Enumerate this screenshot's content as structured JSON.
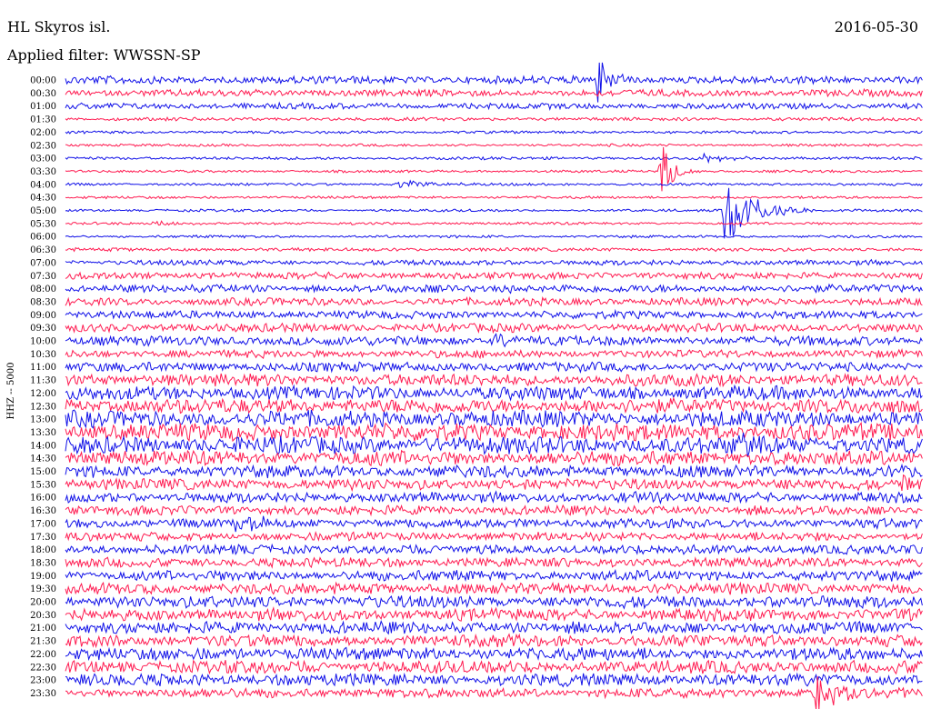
{
  "header": {
    "station": "HL Skyros isl.",
    "filter": "Applied filter: WWSSN-SP",
    "date": "2016-05-30"
  },
  "colors": {
    "trace_a": "#1010e8",
    "trace_b": "#ff1a50",
    "background": "#ffffff"
  },
  "chart_data": {
    "type": "line",
    "title": "",
    "ylabel": "HHZ -- 5000",
    "x_domain_minutes": [
      0,
      30
    ],
    "row_labels": [
      "00:00",
      "00:30",
      "01:00",
      "01:30",
      "02:00",
      "02:30",
      "03:00",
      "03:30",
      "04:00",
      "04:30",
      "05:00",
      "05:30",
      "06:00",
      "06:30",
      "07:00",
      "07:30",
      "08:00",
      "08:30",
      "09:00",
      "09:30",
      "10:00",
      "10:30",
      "11:00",
      "11:30",
      "12:00",
      "12:30",
      "13:00",
      "13:30",
      "14:00",
      "14:30",
      "15:00",
      "15:30",
      "16:00",
      "16:30",
      "17:00",
      "17:30",
      "18:00",
      "18:30",
      "19:00",
      "19:30",
      "20:00",
      "20:30",
      "21:00",
      "21:30",
      "22:00",
      "22:30",
      "23:00",
      "23:30"
    ],
    "noise_level": [
      0.35,
      0.3,
      0.25,
      0.1,
      0.06,
      0.05,
      0.07,
      0.05,
      0.05,
      0.05,
      0.05,
      0.05,
      0.05,
      0.1,
      0.2,
      0.3,
      0.35,
      0.35,
      0.35,
      0.4,
      0.45,
      0.35,
      0.45,
      0.6,
      0.7,
      0.75,
      0.85,
      0.9,
      0.9,
      0.75,
      0.6,
      0.55,
      0.5,
      0.45,
      0.45,
      0.4,
      0.45,
      0.45,
      0.5,
      0.55,
      0.6,
      0.6,
      0.6,
      0.6,
      0.65,
      0.65,
      0.6,
      0.45
    ],
    "events": [
      {
        "row": 0,
        "minute": 18.6,
        "amplitude": 2.0,
        "duration": 0.6
      },
      {
        "row": 7,
        "minute": 20.8,
        "amplitude": 2.4,
        "duration": 0.5
      },
      {
        "row": 6,
        "minute": 22.3,
        "amplitude": 0.4,
        "duration": 1.0
      },
      {
        "row": 8,
        "minute": 11.6,
        "amplitude": 0.45,
        "duration": 1.2
      },
      {
        "row": 10,
        "minute": 23.0,
        "amplitude": 3.0,
        "duration": 1.2
      },
      {
        "row": 11,
        "minute": 3.0,
        "amplitude": 0.2,
        "duration": 1.5
      },
      {
        "row": 16,
        "minute": 15.2,
        "amplitude": 0.4,
        "duration": 0.6
      },
      {
        "row": 20,
        "minute": 15.0,
        "amplitude": 0.6,
        "duration": 0.8
      },
      {
        "row": 28,
        "minute": 23.2,
        "amplitude": 0.9,
        "duration": 1.0
      },
      {
        "row": 31,
        "minute": 29.2,
        "amplitude": 0.8,
        "duration": 1.0
      },
      {
        "row": 32,
        "minute": 19.3,
        "amplitude": 0.6,
        "duration": 0.7
      },
      {
        "row": 34,
        "minute": 5.8,
        "amplitude": 0.9,
        "duration": 1.2
      },
      {
        "row": 47,
        "minute": 26.2,
        "amplitude": 1.8,
        "duration": 1.2
      }
    ]
  }
}
